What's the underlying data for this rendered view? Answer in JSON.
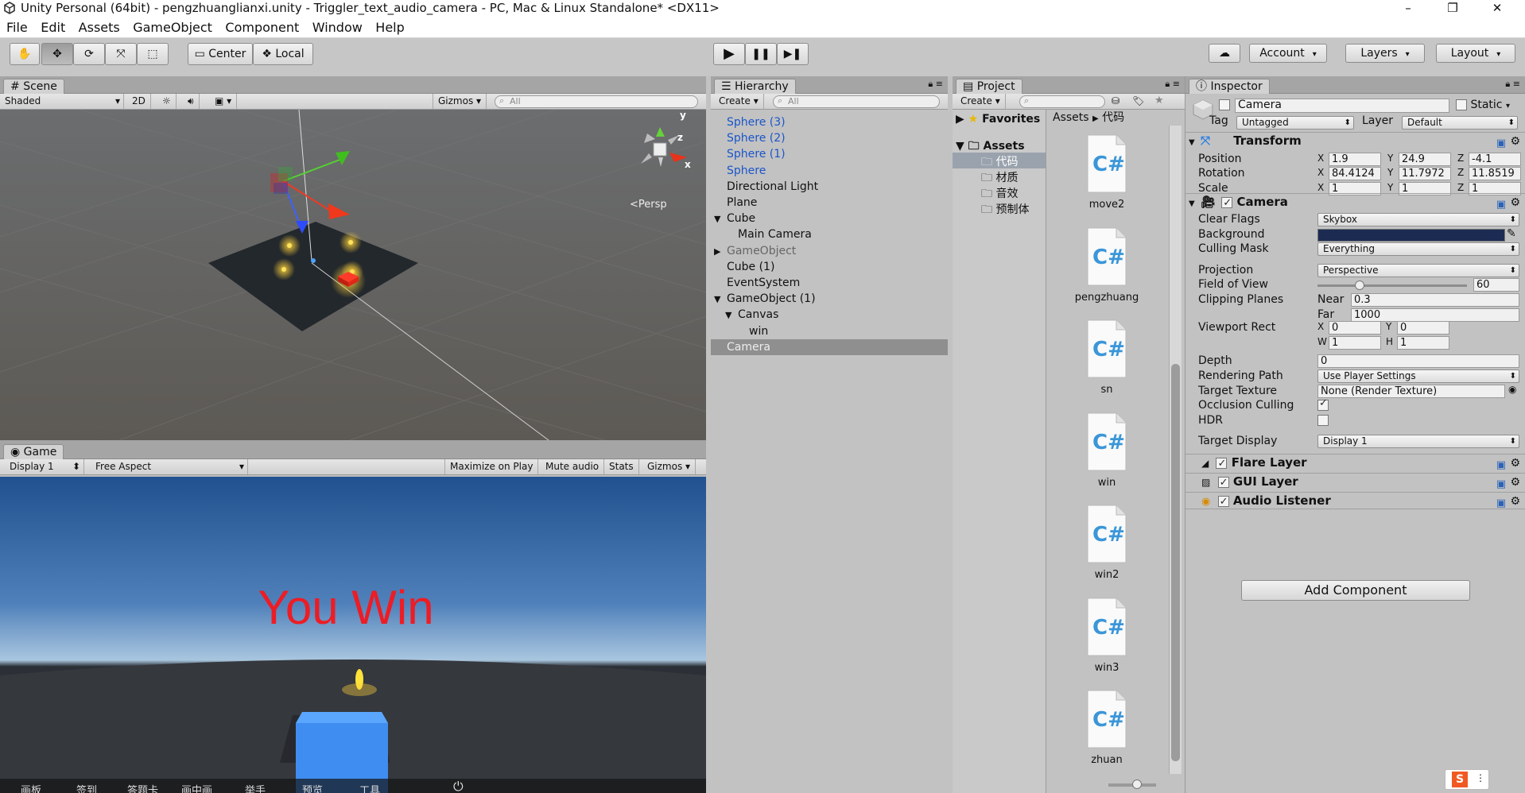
{
  "window": {
    "title": "Unity Personal (64bit) - pengzhuanglianxi.unity - Triggler_text_audio_camera - PC, Mac & Linux Standalone* <DX11>",
    "minimize": "–",
    "restore": "❐",
    "close": "✕"
  },
  "menu": [
    "File",
    "Edit",
    "Assets",
    "GameObject",
    "Component",
    "Window",
    "Help"
  ],
  "toolbar": {
    "pivot": "Center",
    "space": "Local",
    "account": "Account",
    "layers": "Layers",
    "layout": "Layout"
  },
  "scene": {
    "tab": "Scene",
    "shading": "Shaded",
    "mode2d": "2D",
    "gizmos": "Gizmos",
    "search": "All",
    "persp": "Persp",
    "axis_y": "y",
    "axis_z": "z",
    "axis_x": "x"
  },
  "game": {
    "tab": "Game",
    "display": "Display 1",
    "aspect": "Free Aspect",
    "maximize": "Maximize on Play",
    "mute": "Mute audio",
    "stats": "Stats",
    "gizmos": "Gizmos",
    "win_text": "You Win"
  },
  "hierarchy": {
    "tab": "Hierarchy",
    "create": "Create",
    "search": "All",
    "items": [
      {
        "label": "Sphere (3)",
        "style": "blue",
        "indent": 0,
        "arrow": ""
      },
      {
        "label": "Sphere (2)",
        "style": "blue",
        "indent": 0,
        "arrow": ""
      },
      {
        "label": "Sphere (1)",
        "style": "blue",
        "indent": 0,
        "arrow": ""
      },
      {
        "label": "Sphere",
        "style": "blue",
        "indent": 0,
        "arrow": ""
      },
      {
        "label": "Directional Light",
        "style": "",
        "indent": 0,
        "arrow": ""
      },
      {
        "label": "Plane",
        "style": "",
        "indent": 0,
        "arrow": ""
      },
      {
        "label": "Cube",
        "style": "",
        "indent": 0,
        "arrow": "▼"
      },
      {
        "label": "Main Camera",
        "style": "",
        "indent": 1,
        "arrow": ""
      },
      {
        "label": "GameObject",
        "style": "grey",
        "indent": 0,
        "arrow": "▶"
      },
      {
        "label": "Cube (1)",
        "style": "",
        "indent": 0,
        "arrow": ""
      },
      {
        "label": "EventSystem",
        "style": "",
        "indent": 0,
        "arrow": ""
      },
      {
        "label": "GameObject (1)",
        "style": "",
        "indent": 0,
        "arrow": "▼"
      },
      {
        "label": "Canvas",
        "style": "",
        "indent": 1,
        "arrow": "▼"
      },
      {
        "label": "win",
        "style": "",
        "indent": 2,
        "arrow": ""
      },
      {
        "label": "Camera",
        "style": "selected",
        "indent": 0,
        "arrow": ""
      }
    ]
  },
  "project": {
    "tab": "Project",
    "create": "Create",
    "favorites": "Favorites",
    "assets_root": "Assets",
    "breadcrumb": [
      "Assets",
      "代码"
    ],
    "folders": [
      "代码",
      "材质",
      "音效",
      "预制体"
    ],
    "scripts": [
      "move2",
      "pengzhuang",
      "sn",
      "win",
      "win2",
      "win3",
      "zhuan"
    ],
    "cs": "C#"
  },
  "inspector": {
    "tab": "Inspector",
    "object_name": "Camera",
    "static": "Static",
    "tag_label": "Tag",
    "tag": "Untagged",
    "layer_label": "Layer",
    "layer": "Default",
    "transform": {
      "title": "Transform",
      "position_label": "Position",
      "position": [
        "1.9",
        "24.9",
        "-4.1"
      ],
      "rotation_label": "Rotation",
      "rotation": [
        "84.4124",
        "11.7972",
        "11.8519"
      ],
      "scale_label": "Scale",
      "scale": [
        "1",
        "1",
        "1"
      ]
    },
    "camera": {
      "title": "Camera",
      "clear_flags_label": "Clear Flags",
      "clear_flags": "Skybox",
      "background_label": "Background",
      "background_color": "#1c2b52",
      "culling_label": "Culling Mask",
      "culling": "Everything",
      "projection_label": "Projection",
      "projection": "Perspective",
      "fov_label": "Field of View",
      "fov": "60",
      "fov_fraction": 0.28,
      "clipping_label": "Clipping Planes",
      "near_label": "Near",
      "near": "0.3",
      "far_label": "Far",
      "far": "1000",
      "viewport_label": "Viewport Rect",
      "vx": "0",
      "vy": "0",
      "vw": "1",
      "vh": "1",
      "depth_label": "Depth",
      "depth": "0",
      "rendering_label": "Rendering Path",
      "rendering": "Use Player Settings",
      "texture_label": "Target Texture",
      "texture": "None (Render Texture)",
      "occlusion_label": "Occlusion Culling",
      "hdr_label": "HDR",
      "display_label": "Target Display",
      "display": "Display 1"
    },
    "components": [
      "Flare Layer",
      "GUI Layer",
      "Audio Listener"
    ],
    "add_component": "Add Component"
  },
  "taskbar": [
    "画板",
    "签到",
    "答题卡",
    "画中画",
    "举手",
    "预览",
    "工具"
  ]
}
